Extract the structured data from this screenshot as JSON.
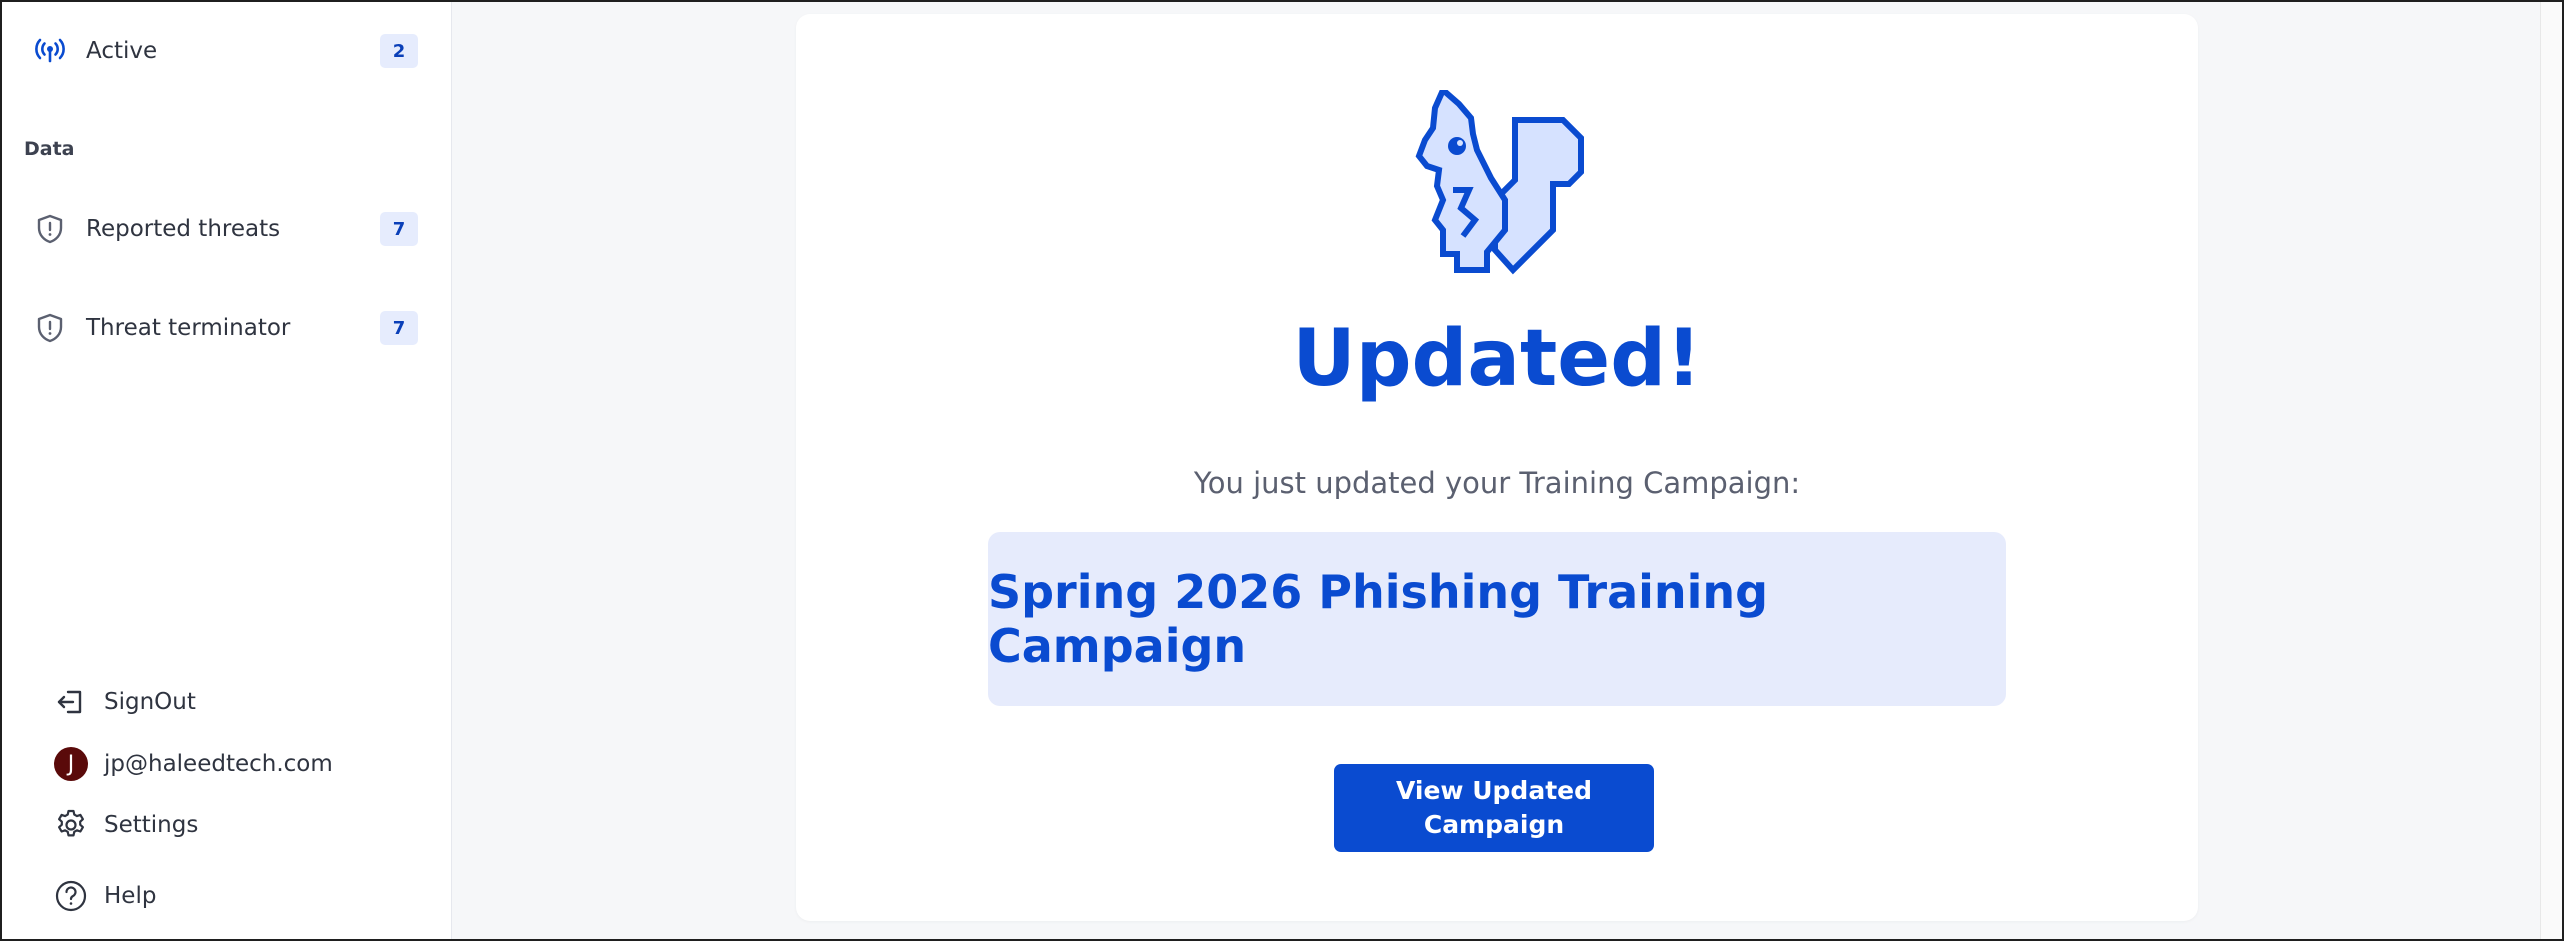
{
  "sidebar": {
    "active": {
      "label": "Active",
      "count": "2"
    },
    "section_label": "Data",
    "items": [
      {
        "label": "Reported threats",
        "count": "7",
        "icon": "shield-alert-icon"
      },
      {
        "label": "Threat terminator",
        "count": "7",
        "icon": "shield-alert-icon"
      }
    ],
    "footer": {
      "signout": "SignOut",
      "user_email": "jp@haleedtech.com",
      "user_initial": "J",
      "settings": "Settings",
      "help": "Help"
    }
  },
  "main": {
    "headline": "Updated!",
    "subtext": "You just updated your Training Campaign:",
    "campaign_name": "Spring 2026 Phishing Training Campaign",
    "cta_label": "View Updated Campaign"
  },
  "colors": {
    "accent": "#0a4bd0",
    "badge_bg": "#e6ecfd",
    "campaign_box_bg": "#e6ebfc",
    "main_bg": "#f6f7f9",
    "avatar_bg": "#5a0a0a"
  }
}
